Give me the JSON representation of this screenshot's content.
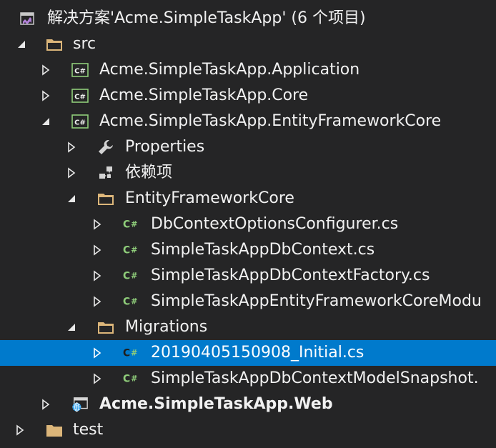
{
  "solution": {
    "label": "解决方案'Acme.SimpleTaskApp' (6 个项目)"
  },
  "tree": {
    "src": "src",
    "application": "Acme.SimpleTaskApp.Application",
    "core": "Acme.SimpleTaskApp.Core",
    "efcore": "Acme.SimpleTaskApp.EntityFrameworkCore",
    "properties": "Properties",
    "dependencies": "依赖项",
    "ef_folder": "EntityFrameworkCore",
    "file_options": "DbContextOptionsConfigurer.cs",
    "file_dbcontext": "SimpleTaskAppDbContext.cs",
    "file_factory": "SimpleTaskAppDbContextFactory.cs",
    "file_module": "SimpleTaskAppEntityFrameworkCoreModu",
    "migrations": "Migrations",
    "file_initial": "20190405150908_Initial.cs",
    "file_snapshot": "SimpleTaskAppDbContextModelSnapshot.",
    "web": "Acme.SimpleTaskApp.Web",
    "test": "test"
  },
  "icons": {
    "solution": "visual-studio-solution-icon",
    "folder": "folder-icon",
    "csproj": "csharp-project-icon",
    "csfile": "csharp-file-icon",
    "wrench": "wrench-icon",
    "dependencies": "dependencies-icon",
    "webproject": "web-project-icon",
    "expanded": "triangle-expanded-icon",
    "collapsed": "triangle-collapsed-icon"
  },
  "colors": {
    "background": "#252526",
    "selection": "#007acc",
    "text": "#f1f1f1",
    "folder": "#dcb67a",
    "csharp": "#8fcd7a",
    "solution": "#b180d7"
  }
}
